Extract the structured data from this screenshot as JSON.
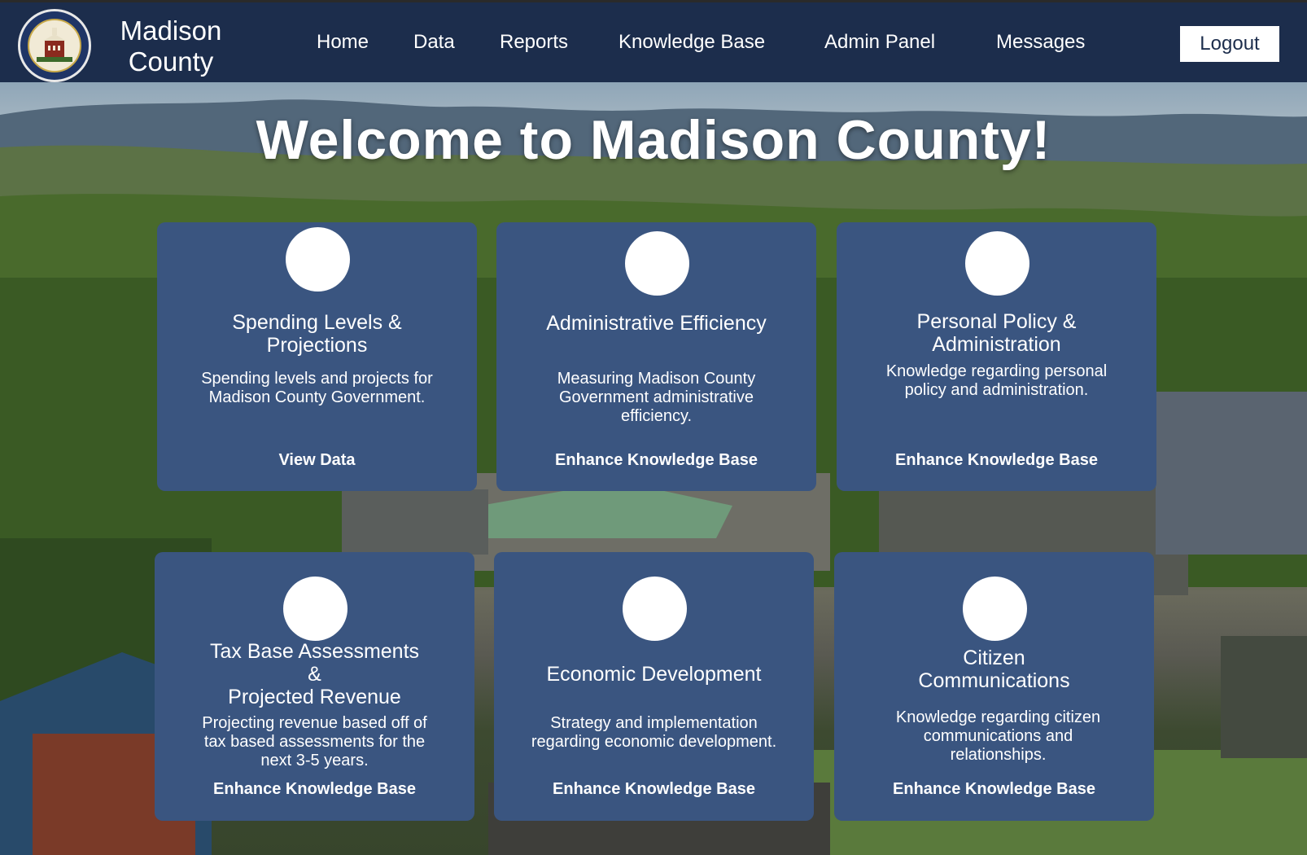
{
  "header": {
    "brand_line1": "Madison",
    "brand_line2": "County",
    "nav": [
      "Home",
      "Data",
      "Reports",
      "Knowledge Base",
      "Admin Panel",
      "Messages"
    ],
    "logout_label": "Logout"
  },
  "hero": {
    "title": "Welcome to Madison County!"
  },
  "cards": [
    {
      "title": "Spending Levels &\nProjections",
      "description": "Spending levels and projects for Madison County Government.",
      "action": "View Data"
    },
    {
      "title": "Administrative Efficiency",
      "description": "Measuring Madison County Government administrative efficiency.",
      "action": "Enhance Knowledge Base"
    },
    {
      "title": "Personal Policy &\nAdministration",
      "description": "Knowledge regarding personal policy and administration.",
      "action": "Enhance Knowledge Base"
    },
    {
      "title": "Tax Base Assessments\n&\nProjected Revenue",
      "description": "Projecting revenue based off of tax based assessments for the next 3-5 years.",
      "action": "Enhance Knowledge Base"
    },
    {
      "title": "Economic Development",
      "description": "Strategy and implementation regarding economic development.",
      "action": "Enhance Knowledge Base"
    },
    {
      "title": "Citizen\nCommunications",
      "description": "Knowledge regarding citizen communications and relationships.",
      "action": "Enhance Knowledge Base"
    }
  ],
  "colors": {
    "navbar": "#1c2d4c",
    "card": "#3a5580",
    "text": "#ffffff"
  }
}
